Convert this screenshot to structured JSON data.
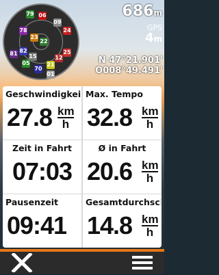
{
  "header": {
    "elevation": "686",
    "elevation_unit": "m",
    "gps_label": "GPS",
    "gps_accuracy": "4",
    "gps_accuracy_unit": "m",
    "latitude": "N  47°21.901'",
    "longitude": "O008°49.491'"
  },
  "satellites": [
    {
      "id": "79",
      "color": "#2e8b2e"
    },
    {
      "id": "06",
      "color": "#c01010"
    },
    {
      "id": "09",
      "color": "#888888"
    },
    {
      "id": "24",
      "color": "#c82020"
    },
    {
      "id": "78",
      "color": "#8a28a8"
    },
    {
      "id": "23",
      "color": "#c87a10"
    },
    {
      "id": "22",
      "color": "#2e7a2e"
    },
    {
      "id": "81",
      "color": "#6a2a8a"
    },
    {
      "id": "82",
      "color": "#3a3ab0"
    },
    {
      "id": "25",
      "color": "#c83030"
    },
    {
      "id": "15",
      "color": "#777777"
    },
    {
      "id": "05",
      "color": "#2a8a2a"
    },
    {
      "id": "12",
      "color": "#b03030"
    },
    {
      "id": "21",
      "color": "#c8c820"
    },
    {
      "id": "70",
      "color": "#2a2aa0"
    },
    {
      "id": "01",
      "color": "#9a9a9a"
    }
  ],
  "fields": [
    {
      "label": "Geschwindigkeit",
      "value": "27.8",
      "unit_top": "km",
      "unit_bottom": "h"
    },
    {
      "label": "Max. Tempo",
      "value": "32.8",
      "unit_top": "km",
      "unit_bottom": "h"
    },
    {
      "label": "Zeit in Fahrt",
      "value": "07:03"
    },
    {
      "label": "Ø in Fahrt",
      "value": "20.6",
      "unit_top": "km",
      "unit_bottom": "h"
    },
    {
      "label": "Pausenzeit",
      "value": "09:41"
    },
    {
      "label": "Gesamtdurchsch",
      "value": "14.8",
      "unit_top": "km",
      "unit_bottom": "h"
    }
  ],
  "icons": {
    "close": "close-icon",
    "menu": "menu-icon"
  },
  "colors": {
    "accent": "#e67817",
    "bar": "#2b2b2b"
  }
}
